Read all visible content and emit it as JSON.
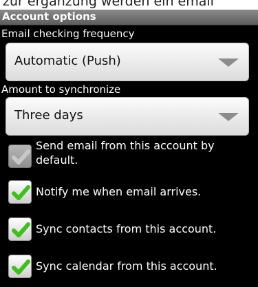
{
  "top_text": "zur ergänzung werden ein email",
  "title": "Account options",
  "frequency": {
    "label": "Email checking frequency",
    "value": "Automatic (Push)"
  },
  "sync_amount": {
    "label": "Amount to synchronize",
    "value": "Three days"
  },
  "options": [
    {
      "label_line1": "Send email from this account by",
      "label_line2": "default.",
      "checked": true,
      "disabled": true
    },
    {
      "label": "Notify me when email arrives.",
      "checked": true,
      "disabled": false
    },
    {
      "label": "Sync contacts from this account.",
      "checked": true,
      "disabled": false
    },
    {
      "label": "Sync calendar from this account.",
      "checked": true,
      "disabled": false
    }
  ],
  "colors": {
    "check_green": "#3fbf1f",
    "check_disabled": "#c8c8c8",
    "titlebar": "#6e6e6e"
  }
}
